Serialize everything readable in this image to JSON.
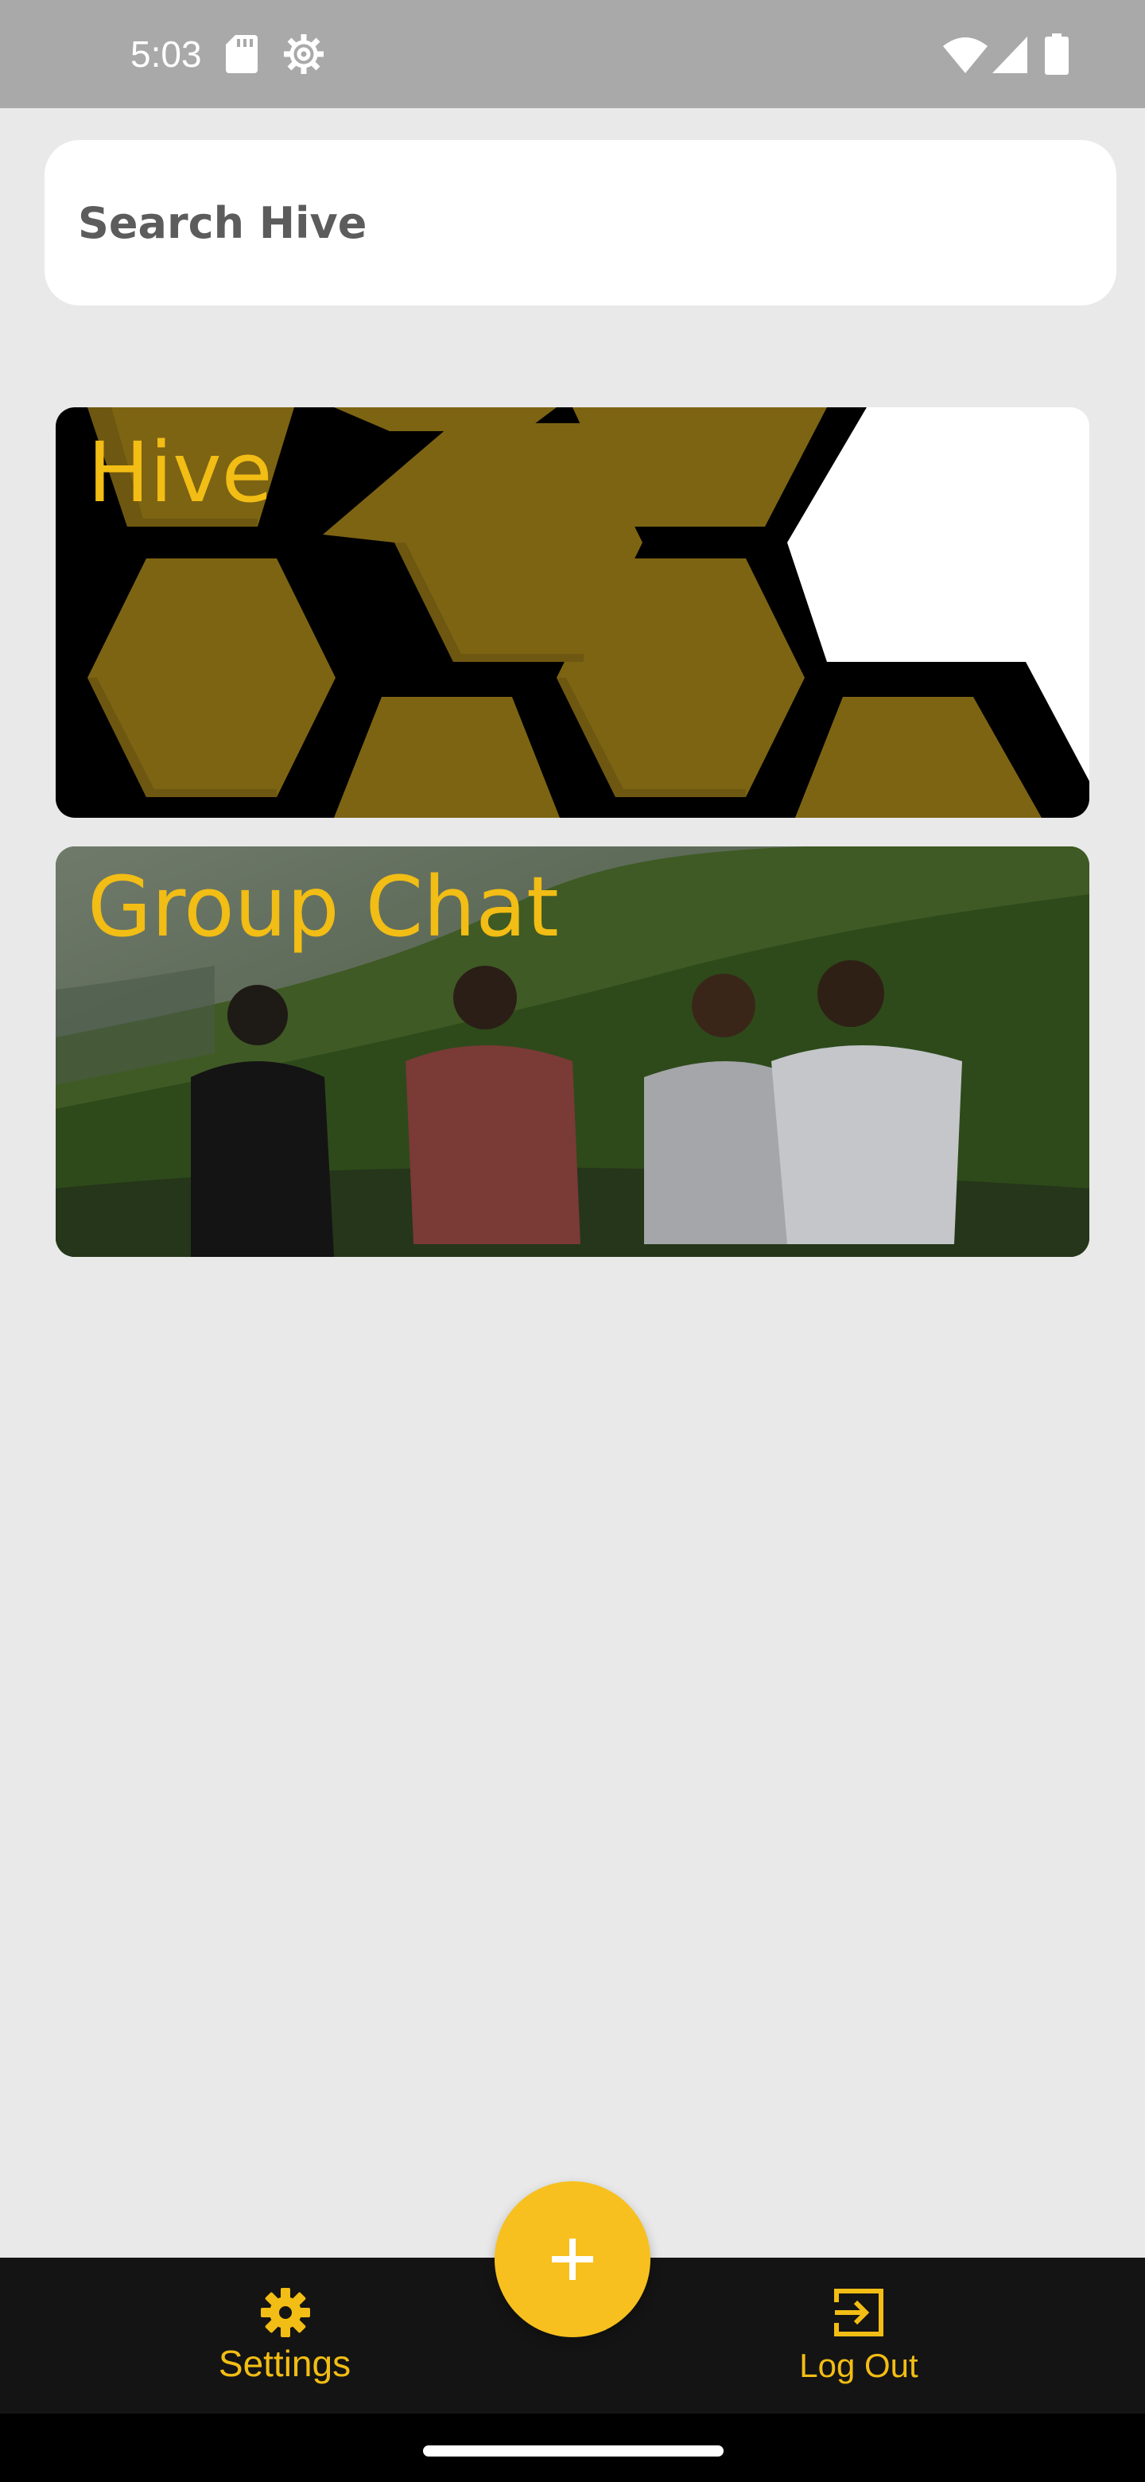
{
  "status_bar": {
    "time": "5:03",
    "icons": [
      "sd-card-icon",
      "settings-status-icon",
      "wifi-icon",
      "signal-icon",
      "battery-icon"
    ]
  },
  "search": {
    "placeholder": "Search Hive",
    "value": ""
  },
  "cards": [
    {
      "title": "Hive",
      "image": "honeycomb-pattern"
    },
    {
      "title": "Group Chat",
      "image": "friends-on-hillside-photo"
    }
  ],
  "bottom_nav": {
    "settings_label": "Settings",
    "logout_label": "Log Out",
    "fab_icon": "plus-icon"
  },
  "colors": {
    "accent": "#F2BD14",
    "fab": "#F7C01E",
    "nav_background": "#141414",
    "status_bar": "#A9A9A9",
    "page_background": "#E9E9E9"
  }
}
